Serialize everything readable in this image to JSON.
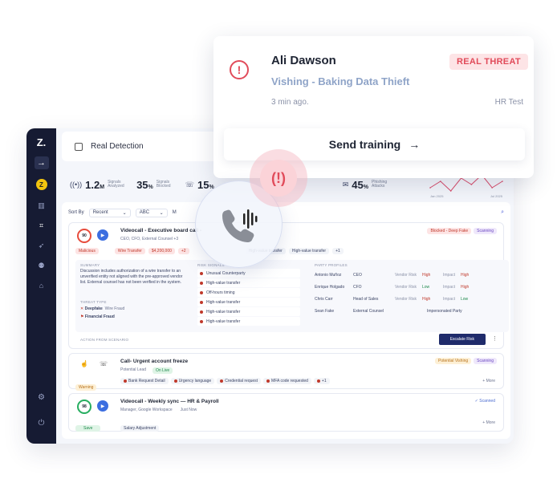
{
  "notification": {
    "name": "Ali Dawson",
    "tag": "REAL THREAT",
    "subtitle": "Vishing - Baking Data Thieft",
    "time": "3 min ago.",
    "source": "HR Test",
    "button_label": "Send training",
    "button_arrow": "→"
  },
  "sidebar": {
    "logo": "Z.",
    "avatar_initial": "Z"
  },
  "header": {
    "title": "Real Detection"
  },
  "stats": [
    {
      "value": "1.2",
      "unit": "M",
      "label": "Signals Analyzed"
    },
    {
      "value": "35",
      "unit": "%",
      "label": "Signals Blocked"
    },
    {
      "value": "15",
      "unit": "%",
      "label": ""
    },
    {
      "value": "45",
      "unit": "%",
      "label": "Phishing Attacks"
    }
  ],
  "chart_data": {
    "type": "line",
    "x": [
      "Jan 2025",
      "",
      "",
      "",
      "",
      "",
      "",
      "Jul 2025"
    ],
    "values": [
      4,
      6,
      3,
      7,
      5,
      8,
      4,
      6
    ],
    "xlabels": [
      "Jan 2025",
      "Jul 2025"
    ]
  },
  "sort": {
    "label": "Sort By",
    "option1": "Recent",
    "option2": "ABC",
    "filter": "M"
  },
  "card1": {
    "score": "90",
    "title": "Videocall - Executive board call -",
    "participants": "CEO, CFO, External Counsel +3",
    "status_chip": "Blocked - Deep Fake",
    "scan_chip": "Scanning",
    "malicious_chip": "Malicious",
    "wire_chip": "Wire Transfer",
    "amount_chip": "$4,200,000",
    "plus_chip": "+2",
    "hv_chip1": "High-value transfer",
    "hv_chip2": "High-value transfer",
    "plus1": "+1",
    "summary_head": "SUMMARY",
    "summary": "Discussion includes authorization of a wire transfer to an unverified entity not aligned with the pre-approved vendor list. External counsel has not been verified in the system.",
    "threat_head": "THREAT TYPE",
    "threat1": "Deepfake",
    "threat1_sub": "Wire Fraud",
    "threat2": "Financial Fraud",
    "risk_head": "RISK SIGNALS",
    "risks": [
      "Unusual Counterparty",
      "High-value transfer",
      "Off-hours timing",
      "High-value transfer",
      "High-value transfer",
      "High-value transfer"
    ],
    "party_head": "PARTY PROFILES",
    "parties": [
      {
        "name": "Antonio Muñoz",
        "role": "CEO",
        "vendor": "Vendor Risk",
        "vendor_level": "High",
        "impact": "Impact",
        "impact_level": "High"
      },
      {
        "name": "Enrique Holgado",
        "role": "CFO",
        "vendor": "Vendor Risk",
        "vendor_level": "Low",
        "impact": "Impact",
        "impact_level": "High"
      },
      {
        "name": "Chris Carr",
        "role": "Head of Sales",
        "vendor": "Vendor Risk",
        "vendor_level": "High",
        "impact": "Impact",
        "impact_level": "Low"
      },
      {
        "name": "Sean Fake",
        "role": "External Counsel",
        "vendor": "Impersonated Party",
        "vendor_level": "",
        "impact": "",
        "impact_level": ""
      }
    ],
    "action_head": "ACTION FROM SCENARIO",
    "escalate": "Escalate Risk"
  },
  "card2": {
    "title": "Call-  Urgent account freeze",
    "lead": "Potential Lead",
    "live": "On Live",
    "status_chip": "Potential Vishing",
    "scan_chip": "Scanning",
    "warning": "Warning",
    "tags": [
      "Bank Request Detail",
      "Urgency language",
      "Credential request",
      "MFA code requested",
      "+1"
    ],
    "more": "+ More"
  },
  "card3": {
    "score": "98",
    "title": "Videocall - Weekly sync — HR & Payroll",
    "participants": "Manager, Google Workspace",
    "time": "Just Now",
    "status": "Scanned",
    "save": "Save",
    "tag": "Salary Adjustment",
    "more": "+ More"
  }
}
